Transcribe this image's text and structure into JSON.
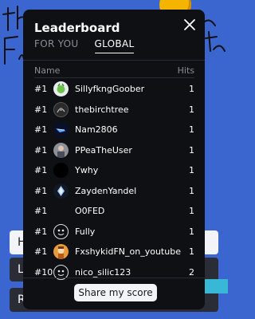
{
  "modal": {
    "title": "Leaderboard",
    "tabs": [
      {
        "label": "FOR YOU",
        "active": false
      },
      {
        "label": "GLOBAL",
        "active": true
      }
    ],
    "columns": {
      "name": "Name",
      "hits": "Hits"
    },
    "rows": [
      {
        "rank": "#1",
        "name": "SillyfkngGoober",
        "hits": "1",
        "avatar": "green-creature"
      },
      {
        "rank": "#1",
        "name": "thebirchtree",
        "hits": "1",
        "avatar": "dark-scribble"
      },
      {
        "rank": "#1",
        "name": "Nam2806",
        "hits": "1",
        "avatar": "blue-glow"
      },
      {
        "rank": "#1",
        "name": "PPeaTheUser",
        "hits": "1",
        "avatar": "gray-character"
      },
      {
        "rank": "#1",
        "name": "Ywhy",
        "hits": "1",
        "avatar": "black"
      },
      {
        "rank": "#1",
        "name": "ZaydenYandel",
        "hits": "1",
        "avatar": "crystal"
      },
      {
        "rank": "#1",
        "name": "O0FED",
        "hits": "1",
        "avatar": "none"
      },
      {
        "rank": "#1",
        "name": "Fully",
        "hits": "1",
        "avatar": "face-sketch"
      },
      {
        "rank": "#1",
        "name": "FxshykidFN_on_youtube",
        "hits": "1",
        "avatar": "orange-character"
      },
      {
        "rank": "#10",
        "name": "nico_silic123",
        "hits": "2",
        "avatar": "face-sketch"
      }
    ],
    "share_label": "Share my score"
  },
  "background": {
    "buttons": [
      {
        "label": "H"
      },
      {
        "label": "L"
      },
      {
        "label": "R"
      }
    ]
  },
  "colors": {
    "background": "#3b66cf",
    "modal": "#0f1014",
    "button": "#f3f4f8",
    "muted_text": "#8b8d93"
  }
}
